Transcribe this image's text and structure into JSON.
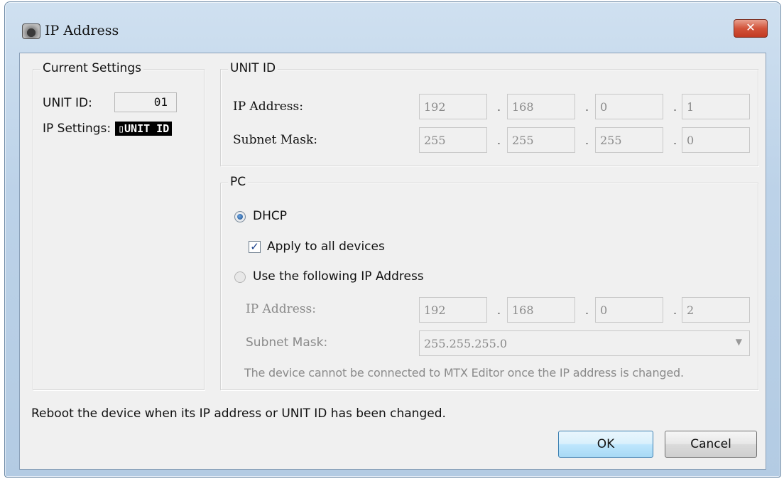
{
  "window": {
    "title": "IP Address",
    "close_glyph": "✕"
  },
  "current_settings": {
    "group_label": "Current Settings",
    "unit_id_label": "UNIT ID:",
    "unit_id_value": "01",
    "ip_settings_label": "IP Settings:",
    "ip_settings_value": "UNIT ID"
  },
  "unit_id_group": {
    "group_label": "UNIT ID",
    "ip_label": "IP Address:",
    "ip_octets": [
      "192",
      "168",
      "0",
      "1"
    ],
    "subnet_label": "Subnet Mask:",
    "subnet_octets": [
      "255",
      "255",
      "255",
      "0"
    ],
    "separator": "."
  },
  "pc_group": {
    "group_label": "PC",
    "dhcp_label": "DHCP",
    "dhcp_selected": true,
    "apply_all_label": "Apply to all devices",
    "apply_all_checked": true,
    "checkbox_glyph": "✓",
    "use_following_label": "Use the following IP Address",
    "ip_label": "IP Address:",
    "ip_octets": [
      "192",
      "168",
      "0",
      "2"
    ],
    "subnet_label": "Subnet Mask:",
    "subnet_value": "255.255.255.0",
    "combo_arrow": "▼",
    "warning": "The device cannot be connected to MTX Editor once the IP address is changed."
  },
  "footer": {
    "note": "Reboot the device when its IP address or UNIT ID has been changed.",
    "ok_label": "OK",
    "cancel_label": "Cancel"
  },
  "icons": {
    "app": "app-icon",
    "close": "close-icon",
    "radio": "radio-button",
    "checkbox": "checkbox",
    "dropdown": "chevron-down-icon"
  }
}
